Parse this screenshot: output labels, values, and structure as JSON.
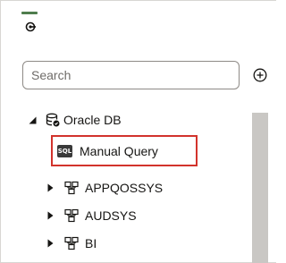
{
  "search": {
    "placeholder": "Search"
  },
  "tree": {
    "root": {
      "label": "Oracle DB",
      "icon": "database-icon"
    },
    "manual_query": {
      "label": "Manual Query",
      "badge": "SQL",
      "icon": "sql-icon"
    },
    "schemas": [
      {
        "label": "APPQOSSYS",
        "icon": "schema-icon"
      },
      {
        "label": "AUDSYS",
        "icon": "schema-icon"
      },
      {
        "label": "BI",
        "icon": "schema-icon"
      }
    ]
  },
  "colors": {
    "accent": "#4f7d4d",
    "highlight_border": "#d2332c",
    "scrollbar": "#c9c7c4"
  }
}
